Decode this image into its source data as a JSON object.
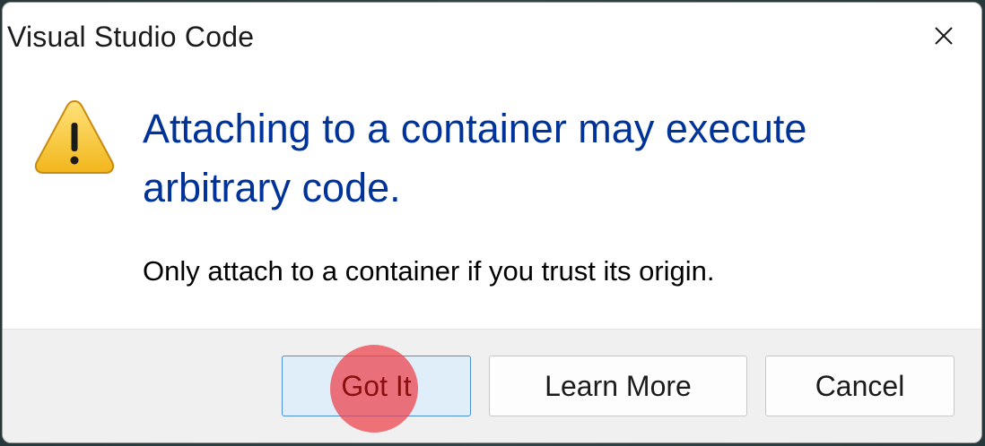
{
  "window": {
    "title": "Visual Studio Code"
  },
  "dialog": {
    "main_instruction": "Attaching to a container may execute arbitrary code.",
    "content": "Only attach to a container if you trust its origin."
  },
  "buttons": {
    "got_it": "Got It",
    "learn_more": "Learn More",
    "cancel": "Cancel"
  },
  "icons": {
    "warning": "warning-icon",
    "close": "close-icon"
  },
  "colors": {
    "instruction_text": "#003399",
    "default_button_border": "#4a90d9",
    "default_button_bg": "#e0eef9",
    "warning_fill": "#f7c32a",
    "click_marker": "#ec4048"
  }
}
